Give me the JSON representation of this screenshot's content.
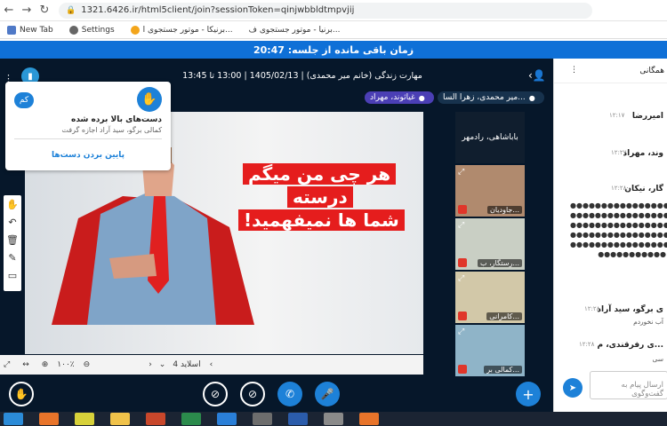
{
  "browser": {
    "url": "1321.6426.ir/html5client/join?sessionToken=qinjwbbldtmpvjij",
    "bookmarks": [
      "New Tab",
      "Settings",
      "برنیکا - موتور جستجوی ا...",
      "برنیا - موتور جستجوی ف..."
    ]
  },
  "banner": {
    "text": "زمان باقی مانده از جلسه: 20:47"
  },
  "session": {
    "title": "مهارت زندگی (خانم میر محمدی) | 1405/02/13 | 13:00 تا 13:45"
  },
  "talkers": [
    "میر محمدی، زهرا السا...",
    "غیاثوند، مهراد"
  ],
  "raise_hand_popup": {
    "title": "دست‌های بالا برده شده",
    "subtitle": "کمالی برگو، سید آراد اجازه گرفت",
    "action": "پایین بردن دست‌ها",
    "lower_label": "کم"
  },
  "slide": {
    "lines": [
      "هر چی من میگم",
      "درسته",
      "!شما ها نمیفهمید"
    ],
    "label": "اسلاید 4",
    "zoom": "۱۰۰٪"
  },
  "webcams": {
    "speaker": "باباشاهی، رادمهر",
    "tiles": [
      "جاودیان...",
      "رستگار، ب...",
      "کامرانی...",
      "کمالی بر..."
    ]
  },
  "chat": {
    "header": "همگانی",
    "messages": [
      {
        "name": "امیررضا",
        "time": "۱۲:۱۷",
        "body": ""
      },
      {
        "name": "وند، مهراد",
        "time": "۱۲:۲۷",
        "body": ""
      },
      {
        "name": "گار، نیکان",
        "time": "۱۲:۲۸",
        "body": ""
      },
      {
        "name": "ی برگو، سید آراد",
        "time": "۱۲:۲۸",
        "body": "آب نخوردم"
      },
      {
        "name": "ی رفرقندی، م...",
        "time": "۱۲:۲۸",
        "body": "سی"
      }
    ],
    "input_placeholder": "ارسال پیام به گفت‌وگوی"
  },
  "colors": {
    "primary": "#1d81d8",
    "banner": "#0f70d7",
    "dark_bg": "#06172a",
    "slide_red": "#e51d1d"
  }
}
